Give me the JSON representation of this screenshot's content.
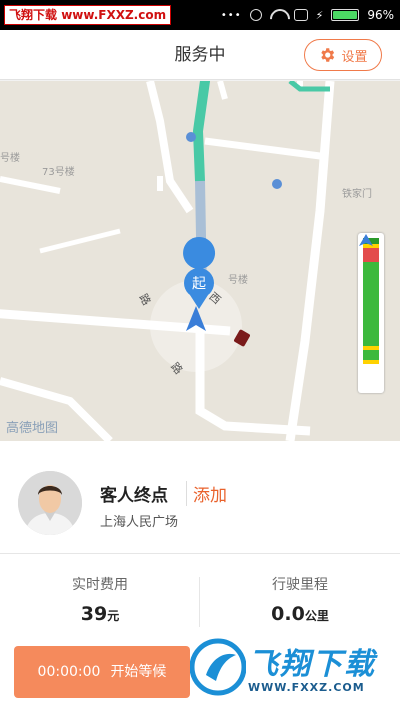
{
  "watermark_top": {
    "part1": "飞翔下载",
    "part2": "www.FXXZ.com"
  },
  "status": {
    "battery": "96%"
  },
  "header": {
    "title": "服务中",
    "settings_label": "设置"
  },
  "map": {
    "labels": [
      "号楼",
      "73号楼",
      "铁家门",
      "号楼"
    ],
    "provider_logo": "高德地图",
    "start_marker": "起"
  },
  "destination": {
    "label": "客人终点",
    "add_label": "添加",
    "place": "上海人民广场"
  },
  "metrics": {
    "fee": {
      "label": "实时费用",
      "value": "39",
      "unit": "元"
    },
    "mileage": {
      "label": "行驶里程",
      "value": "0.0",
      "unit": "公里"
    }
  },
  "actions": {
    "timer": "00:00:00",
    "start_label": "开始等候"
  },
  "watermark_bottom": {
    "logo": "飞翔下载",
    "url": "WWW.FXXZ.COM"
  }
}
